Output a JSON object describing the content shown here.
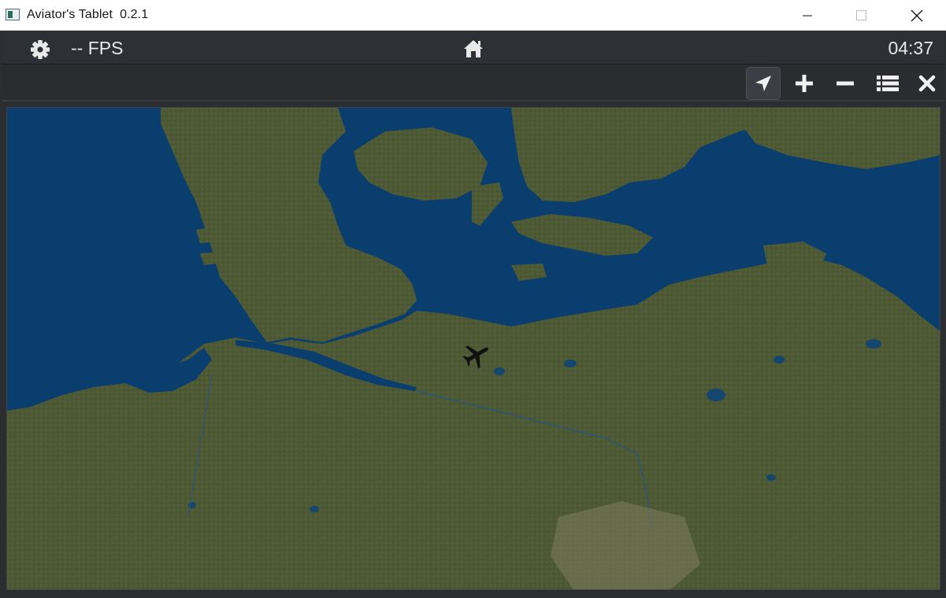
{
  "window": {
    "title": "Aviator's Tablet  0.2.1"
  },
  "topbar": {
    "fps_label": "-- FPS",
    "clock": "04:37",
    "icons": [
      "gear-icon",
      "home-icon"
    ]
  },
  "toolbar": {
    "icons": [
      "navigation-arrow-icon",
      "plus-icon",
      "minus-icon",
      "list-icon",
      "close-icon"
    ],
    "active": "navigation-arrow-icon"
  },
  "colors": {
    "sea": "#0a3e6e",
    "land": "#4e5a35",
    "bar": "#2d3035",
    "text": "#e8e8e8",
    "aircraft": "#111111"
  }
}
